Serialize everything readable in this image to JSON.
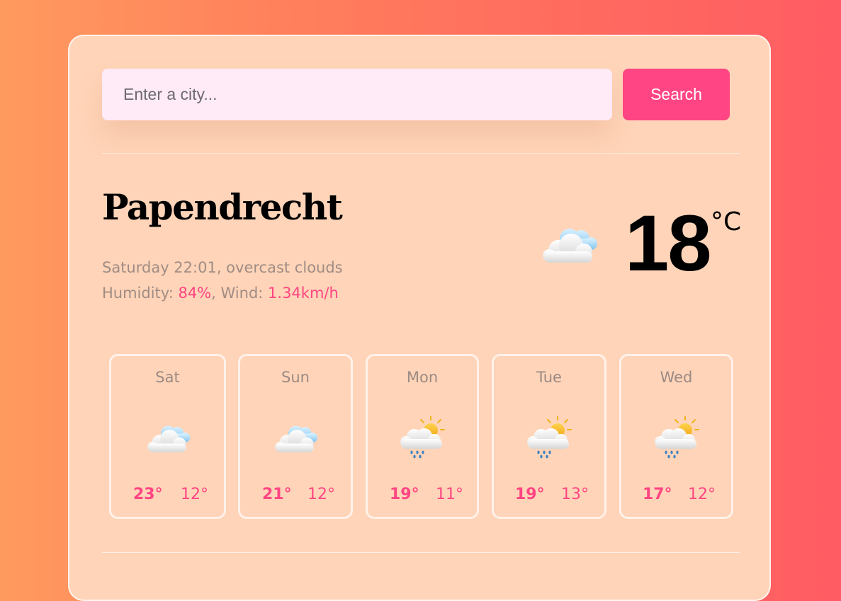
{
  "search": {
    "placeholder": "Enter a city...",
    "button_label": "Search"
  },
  "current": {
    "city": "Papendrecht",
    "datetime_desc": "Saturday 22:01, overcast clouds",
    "humidity_label": "Humidity: ",
    "humidity_value": "84%",
    "wind_label": ", Wind: ",
    "wind_value": "1.34km/h",
    "temperature": "18",
    "unit": "°C",
    "icon": "cloud-icon"
  },
  "forecast": [
    {
      "day": "Sat",
      "high": "23°",
      "low": "12°",
      "icon": "cloud-icon"
    },
    {
      "day": "Sun",
      "high": "21°",
      "low": "12°",
      "icon": "cloud-icon"
    },
    {
      "day": "Mon",
      "high": "19°",
      "low": "11°",
      "icon": "rain-sun-icon"
    },
    {
      "day": "Tue",
      "high": "19°",
      "low": "13°",
      "icon": "rain-sun-icon"
    },
    {
      "day": "Wed",
      "high": "17°",
      "low": "12°",
      "icon": "rain-sun-icon"
    }
  ],
  "colors": {
    "accent": "#ff4583",
    "card_bg": "#ffd4b8",
    "input_bg": "#ffeaf7"
  }
}
